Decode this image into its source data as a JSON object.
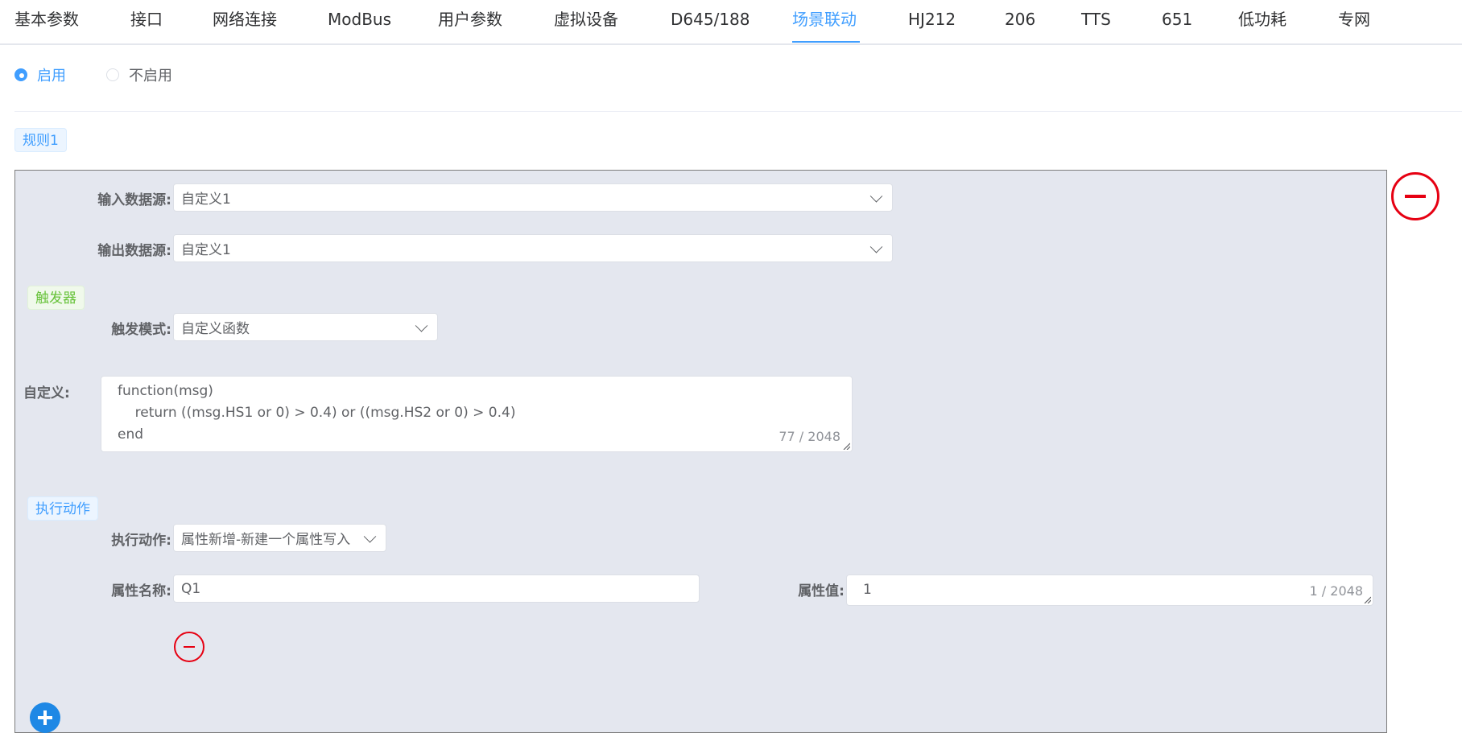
{
  "tabs": [
    {
      "label": "基本参数"
    },
    {
      "label": "接口"
    },
    {
      "label": "网络连接"
    },
    {
      "label": "ModBus"
    },
    {
      "label": "用户参数"
    },
    {
      "label": "虚拟设备"
    },
    {
      "label": "D645/188"
    },
    {
      "label": "场景联动"
    },
    {
      "label": "HJ212"
    },
    {
      "label": "206"
    },
    {
      "label": "TTS"
    },
    {
      "label": "651"
    },
    {
      "label": "低功耗"
    },
    {
      "label": "专网"
    }
  ],
  "active_tab": "场景联动",
  "enable": {
    "options": [
      {
        "label": "启用"
      },
      {
        "label": "不启用"
      }
    ],
    "selected": "启用"
  },
  "rule": {
    "tag": "规则1",
    "input_source": {
      "label": "输入数据源:",
      "value": "自定义1"
    },
    "output_source": {
      "label": "输出数据源:",
      "value": "自定义1"
    },
    "trigger": {
      "tag": "触发器",
      "mode_label": "触发模式:",
      "mode_value": "自定义函数",
      "custom_label": "自定义:",
      "code_lines": [
        "function(msg)",
        "    return ((msg.HS1 or 0) > 0.4) or ((msg.HS2 or 0) > 0.4)",
        "end"
      ],
      "counter": "77 / 2048"
    },
    "action": {
      "tag": "执行动作",
      "action_label": "执行动作:",
      "action_value": "属性新增-新建一个属性写入",
      "prop_name_label": "属性名称:",
      "prop_name_value": "Q1",
      "prop_value_label": "属性值:",
      "prop_value_value": "1",
      "prop_value_counter": "1 / 2048"
    }
  },
  "colors": {
    "accent": "#409eff",
    "danger": "#e60012",
    "panel_bg": "#e4e7ef"
  }
}
